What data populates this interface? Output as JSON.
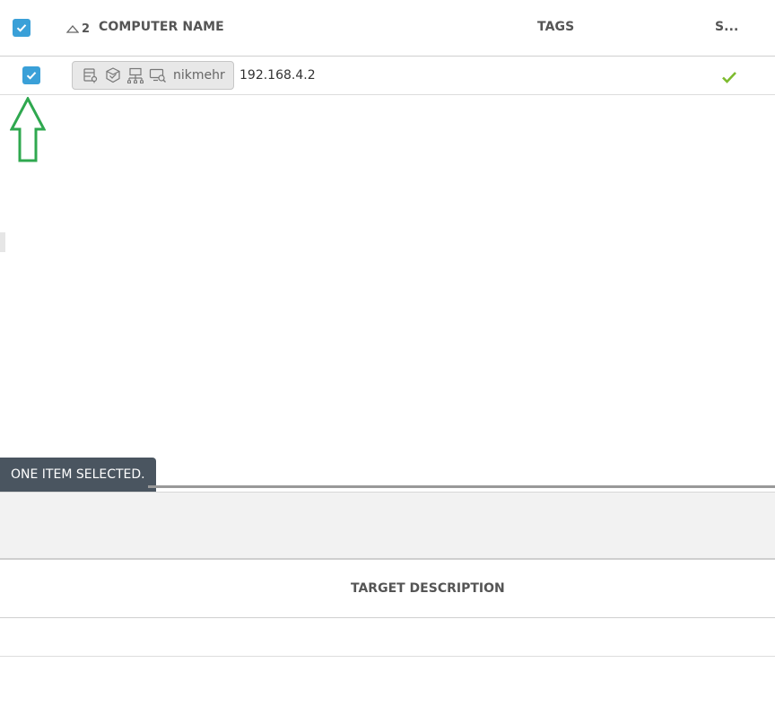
{
  "header": {
    "sort_order": "2",
    "columns": {
      "computer_name": "COMPUTER NAME",
      "tags": "TAGS",
      "status": "S..."
    }
  },
  "rows": [
    {
      "computer_name": "nikmehr",
      "ip_address": "192.168.4.2",
      "icons": [
        "server-location-icon",
        "package-check-icon",
        "network-icon",
        "remote-search-icon"
      ],
      "status_icon": "checkmark-icon"
    }
  ],
  "selection": {
    "message": "ONE ITEM SELECTED."
  },
  "bottom_table": {
    "column": "TARGET DESCRIPTION"
  },
  "colors": {
    "checkbox": "#3aa0d8",
    "status_ok": "#7dbb2e",
    "annotation_arrow": "#2fa84f",
    "toast_bg": "#4a5560"
  }
}
